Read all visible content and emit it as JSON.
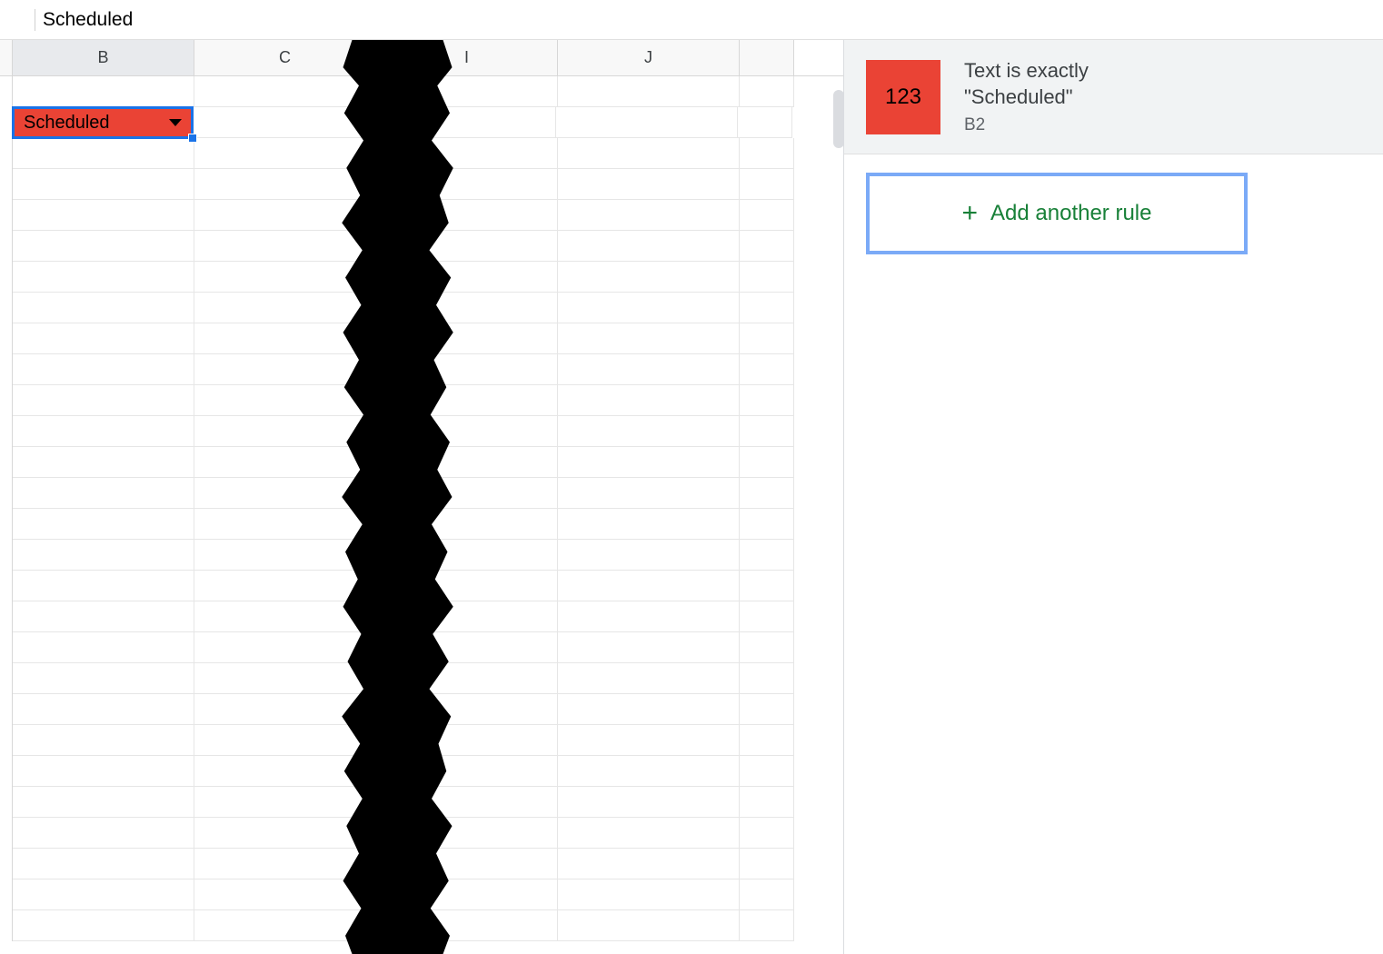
{
  "formula_bar": {
    "value": "Scheduled"
  },
  "columns": [
    "B",
    "C",
    "I",
    "J"
  ],
  "selected_column_index": 0,
  "selected_cell": {
    "value": "Scheduled"
  },
  "rule": {
    "swatch_text": "123",
    "title_line1": "Text is exactly",
    "title_line2": "\"Scheduled\"",
    "range": "B2",
    "swatch_color": "#ea4335"
  },
  "add_rule": {
    "plus": "+",
    "label": "Add another rule"
  },
  "row_count": 28
}
